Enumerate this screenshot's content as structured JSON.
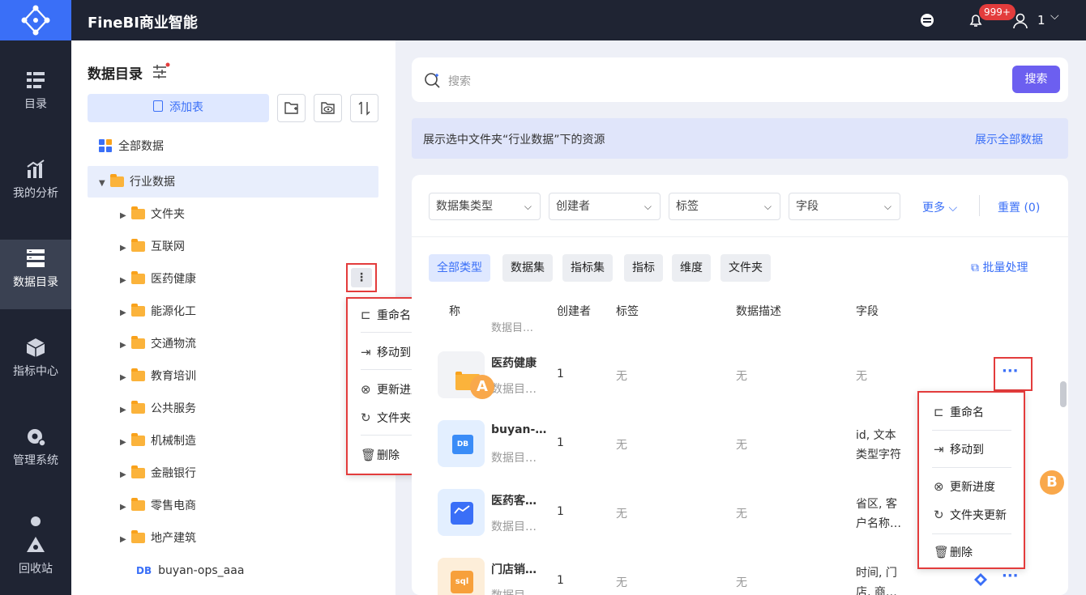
{
  "app": {
    "title": "FineBI商业智能",
    "notif_count": "999+",
    "user": "1"
  },
  "nav": [
    {
      "label": "目录",
      "icon": "catalog-icon"
    },
    {
      "label": "我的分析",
      "icon": "analysis-icon"
    },
    {
      "label": "数据目录",
      "icon": "data-catalog-icon"
    },
    {
      "label": "指标中心",
      "icon": "metric-center-icon"
    },
    {
      "label": "管理系统",
      "icon": "admin-icon"
    },
    {
      "label": "回收站",
      "icon": "recycle-icon"
    }
  ],
  "left": {
    "title": "数据目录",
    "add_table": "添加表",
    "all_data": "全部数据",
    "root": "行业数据",
    "folders": [
      "文件夹",
      "互联网",
      "医药健康",
      "能源化工",
      "交通物流",
      "教育培训",
      "公共服务",
      "机械制造",
      "金融银行",
      "零售电商",
      "地产建筑"
    ],
    "db_badge": "DB",
    "db_item": "buyan-ops_aaa"
  },
  "menu": {
    "rename": "重命名",
    "move": "移动到",
    "update_progress": "更新进度",
    "folder_update": "文件夹更新",
    "delete": "删除"
  },
  "search": {
    "placeholder": "搜索",
    "button": "搜索"
  },
  "banner": {
    "text": "展示选中文件夹“行业数据”下的资源",
    "show_all": "展示全部数据"
  },
  "filters": {
    "dataset_type": "数据集类型",
    "creator": "创建者",
    "tag": "标签",
    "field": "字段",
    "more": "更多",
    "reset": "重置 (0)"
  },
  "chips": [
    "全部类型",
    "数据集",
    "指标集",
    "指标",
    "维度",
    "文件夹"
  ],
  "batch": "批量处理",
  "table": {
    "headers": {
      "name": "称",
      "creator": "创建者",
      "tag": "标签",
      "desc": "数据描述",
      "field": "字段"
    },
    "partial_row": "数据目…",
    "rows": [
      {
        "name": "医药健康",
        "sub": "数据目…",
        "creator": "1",
        "tag": "无",
        "desc": "无",
        "field1": "无",
        "field2": ""
      },
      {
        "name": "buyan-…",
        "sub": "数据目…",
        "creator": "1",
        "tag": "无",
        "desc": "无",
        "field1": "id, 文本",
        "field2": "类型字符"
      },
      {
        "name": "医药客…",
        "sub": "数据目…",
        "creator": "1",
        "tag": "无",
        "desc": "无",
        "field1": "省区, 客",
        "field2": "户名称…"
      },
      {
        "name": "门店销…",
        "sub": "数据目…",
        "creator": "1",
        "tag": "无",
        "desc": "无",
        "field1": "时间, 门",
        "field2": "店, 商…"
      }
    ],
    "db_icon_text": "DB",
    "sql_icon_text": "sql"
  },
  "labels": {
    "a": "A",
    "b": "B"
  },
  "colors": {
    "accent": "#3a6ff7",
    "highlight": "#e33c3c",
    "sidebar": "#1f2433",
    "folder": "#fbb33b"
  }
}
